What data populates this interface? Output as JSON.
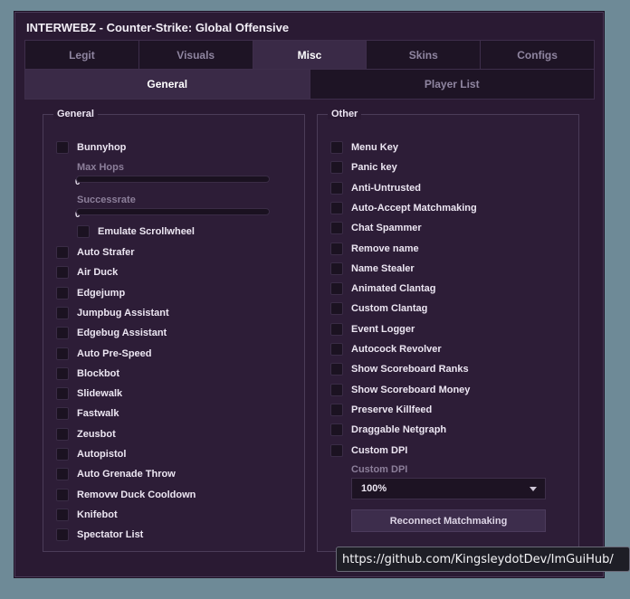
{
  "window": {
    "title": "INTERWEBZ - Counter-Strike: Global Offensive"
  },
  "tabs": [
    {
      "label": "Legit",
      "active": false
    },
    {
      "label": "Visuals",
      "active": false
    },
    {
      "label": "Misc",
      "active": true
    },
    {
      "label": "Skins",
      "active": false
    },
    {
      "label": "Configs",
      "active": false
    }
  ],
  "subtabs": [
    {
      "label": "General",
      "active": true
    },
    {
      "label": "Player List",
      "active": false
    }
  ],
  "general": {
    "title": "General",
    "bunnyhop": "Bunnyhop",
    "max_hops_label": "Max Hops",
    "max_hops_value": "0",
    "successrate_label": "Successrate",
    "successrate_value": "0",
    "emulate_scrollwheel": "Emulate Scrollwheel",
    "items": [
      "Auto Strafer",
      "Air Duck",
      "Edgejump",
      "Jumpbug Assistant",
      "Edgebug Assistant",
      "Auto Pre-Speed",
      "Blockbot",
      "Slidewalk",
      "Fastwalk",
      "Zeusbot",
      "Autopistol",
      "Auto Grenade Throw",
      "Removw Duck Cooldown",
      "Knifebot",
      "Spectator List"
    ]
  },
  "other": {
    "title": "Other",
    "items": [
      "Menu Key",
      "Panic key",
      "Anti-Untrusted",
      "Auto-Accept Matchmaking",
      "Chat Spammer",
      "Remove name",
      "Name Stealer",
      "Animated Clantag",
      "Custom Clantag",
      "Event Logger",
      "Autocock Revolver",
      "Show Scoreboard Ranks",
      "Show Scoreboard Money",
      "Preserve Killfeed",
      "Draggable Netgraph",
      "Custom DPI"
    ],
    "custom_dpi_label": "Custom DPI",
    "custom_dpi_value": "100%",
    "reconnect_button": "Reconnect Matchmaking"
  },
  "tooltip": {
    "text": "https://github.com/KingsleydotDev/ImGuiHub/"
  }
}
